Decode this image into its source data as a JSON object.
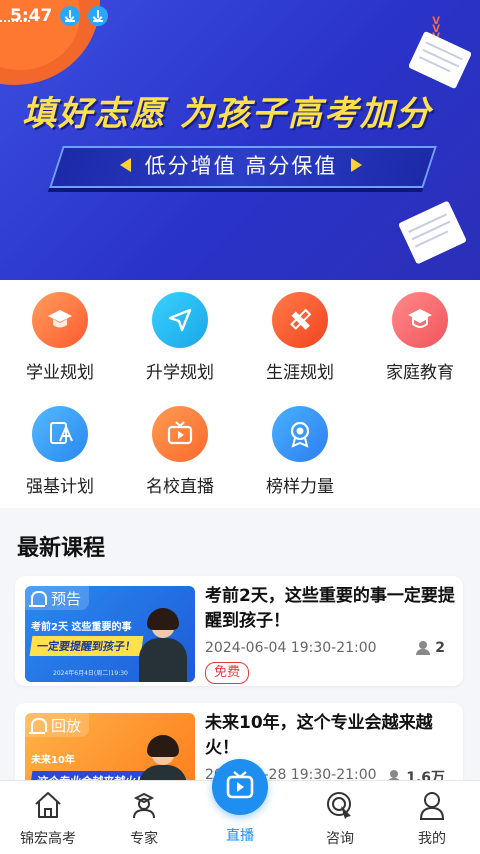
{
  "status": {
    "time": "5:47"
  },
  "banner": {
    "headline": "填好志愿  为孩子高考加分",
    "ribbon": "低分增值  高分保值"
  },
  "menu": [
    {
      "label": "学业规划",
      "icon": "graduation-cap-icon"
    },
    {
      "label": "升学规划",
      "icon": "navigation-arrow-icon"
    },
    {
      "label": "生涯规划",
      "icon": "ruler-pencil-icon"
    },
    {
      "label": "家庭教育",
      "icon": "family-cap-icon"
    },
    {
      "label": "强基计划",
      "icon": "document-pen-icon"
    },
    {
      "label": "名校直播",
      "icon": "tv-play-icon"
    },
    {
      "label": "榜样力量",
      "icon": "medal-icon"
    }
  ],
  "latest": {
    "title": "最新课程",
    "courses": [
      {
        "tag": "预告",
        "thumb_line1": "考前2天  这些重要的事",
        "thumb_line2": "一定要提醒到孩子！",
        "thumb_date": "2024年6月4日(周二)19:30",
        "title": "考前2天，这些重要的事一定要提醒到孩子！",
        "time": "2024-06-04 19:30-21:00",
        "count": "2",
        "badge": "免费"
      },
      {
        "tag": "回放",
        "thumb_line1": "未来10年",
        "thumb_line2": "这个专业会越来越火！",
        "title": "未来10年，这个专业会越来越火！",
        "time": "2024-05-28 19:30-21:00",
        "count": "1.6万"
      }
    ]
  },
  "tabs": [
    {
      "label": "锦宏高考",
      "icon": "home-icon"
    },
    {
      "label": "专家",
      "icon": "expert-icon"
    },
    {
      "label": "直播",
      "icon": "live-play-icon"
    },
    {
      "label": "咨询",
      "icon": "consult-icon"
    },
    {
      "label": "我的",
      "icon": "profile-icon"
    }
  ],
  "colors": {
    "brand_blue": "#2a33c9",
    "accent_yellow": "#ffe14a",
    "live_blue": "#1e8ef0",
    "free_red": "#e63a3a"
  }
}
